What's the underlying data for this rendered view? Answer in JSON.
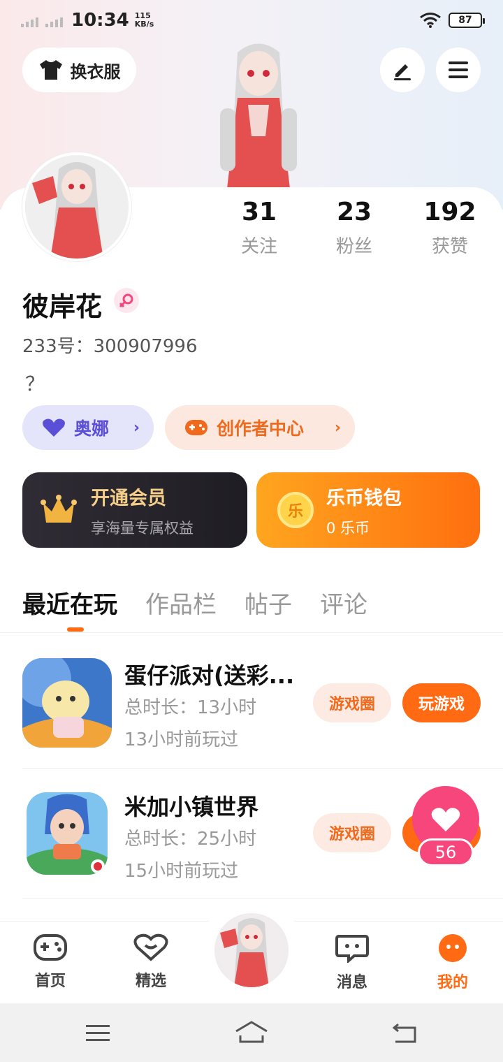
{
  "status_bar": {
    "time": "10:34",
    "net_speed_value": "115",
    "net_speed_unit": "KB/s",
    "battery": "87"
  },
  "header": {
    "dress_button_label": "换衣服"
  },
  "profile": {
    "name": "彼岸花",
    "uid": "233号：300907996",
    "bio": "？",
    "stats": [
      {
        "value": "31",
        "label": "关注"
      },
      {
        "value": "23",
        "label": "粉丝"
      },
      {
        "value": "192",
        "label": "获赞"
      }
    ]
  },
  "pills": {
    "ona": "奥娜",
    "creator": "创作者中心"
  },
  "cards": {
    "vip_title": "开通会员",
    "vip_sub": "享海量专属权益",
    "wallet_title": "乐币钱包",
    "wallet_sub": "0 乐币",
    "coin_char": "乐"
  },
  "tabs": [
    "最近在玩",
    "作品栏",
    "帖子",
    "评论"
  ],
  "games": [
    {
      "name": "蛋仔派对(送彩...",
      "total": "总时长：13小时",
      "last": "13小时前玩过",
      "circle_btn": "游戏圈",
      "play_btn": "玩游戏"
    },
    {
      "name": "米加小镇世界",
      "total": "总时长：25小时",
      "last": "15小时前玩过",
      "circle_btn": "游戏圈",
      "play_btn": "玩游戏"
    }
  ],
  "like_float": {
    "count": "56"
  },
  "bottom_nav": [
    {
      "label": "首页",
      "icon": "gamepad-icon"
    },
    {
      "label": "精选",
      "icon": "heart-chat-icon"
    },
    {
      "label": "消息",
      "icon": "message-icon"
    },
    {
      "label": "我的",
      "icon": "profile-dots-icon"
    }
  ],
  "colors": {
    "accent": "#ff6a13",
    "like": "#f7467c",
    "ona": "#5a4fd6"
  }
}
